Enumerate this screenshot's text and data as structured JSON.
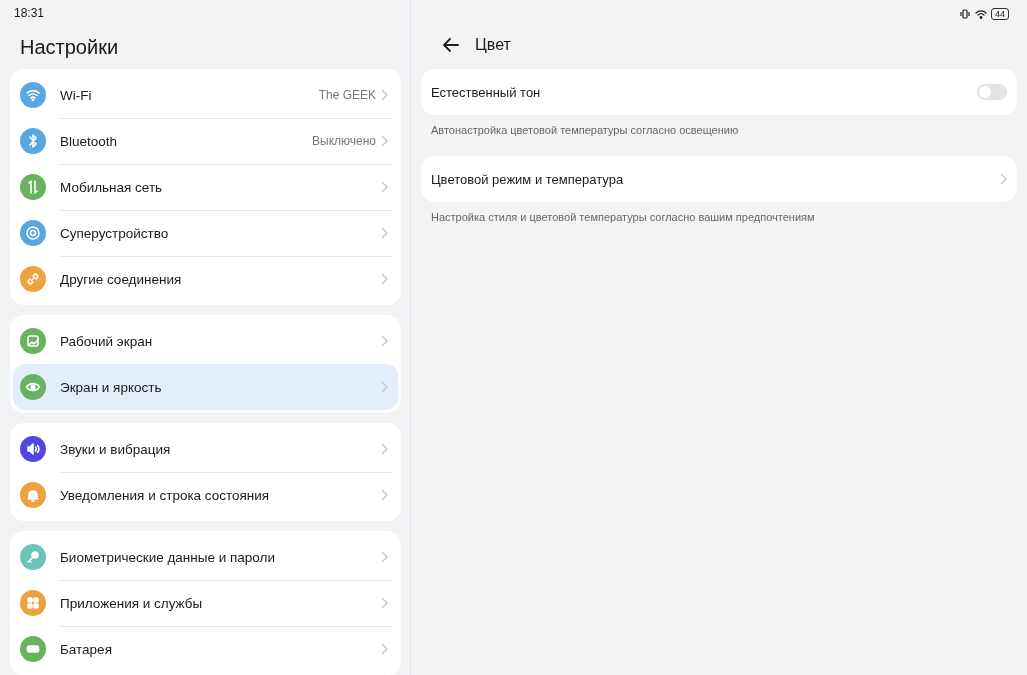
{
  "status_bar": {
    "time": "18:31",
    "battery": "44"
  },
  "sidebar": {
    "title": "Настройки",
    "groups": [
      {
        "items": [
          {
            "label": "Wi-Fi",
            "value": "The GEEK",
            "color": "#5aa6e0",
            "selected": false
          },
          {
            "label": "Bluetooth",
            "value": "Выключено",
            "color": "#5aa6e0",
            "selected": false
          },
          {
            "label": "Мобильная сеть",
            "color": "#6ab160",
            "selected": false
          },
          {
            "label": "Суперустройство",
            "color": "#5aa6e0",
            "selected": false
          },
          {
            "label": "Другие соединения",
            "color": "#eda240",
            "selected": false
          }
        ]
      },
      {
        "items": [
          {
            "label": "Рабочий экран",
            "color": "#6ab160",
            "selected": false
          },
          {
            "label": "Экран и яркость",
            "color": "#6ab160",
            "selected": true
          }
        ]
      },
      {
        "items": [
          {
            "label": "Звуки и вибрация",
            "color": "#5046e0",
            "selected": false
          },
          {
            "label": "Уведомления и строка состояния",
            "color": "#eda240",
            "selected": false
          }
        ]
      },
      {
        "items": [
          {
            "label": "Биометрические данные и пароли",
            "color": "#6cc4b8",
            "selected": false
          },
          {
            "label": "Приложения и службы",
            "color": "#eda240",
            "selected": false
          },
          {
            "label": "Батарея",
            "color": "#6ab160",
            "selected": false
          }
        ]
      }
    ]
  },
  "detail": {
    "title": "Цвет",
    "settings": [
      {
        "kind": "toggle",
        "label": "Естественный тон",
        "on": false,
        "description": "Автонастройка цветовой температуры согласно освещению"
      },
      {
        "kind": "link",
        "label": "Цветовой режим и температура",
        "description": "Настройка стиля и цветовой температуры согласно вашим предпочтениям"
      }
    ]
  }
}
